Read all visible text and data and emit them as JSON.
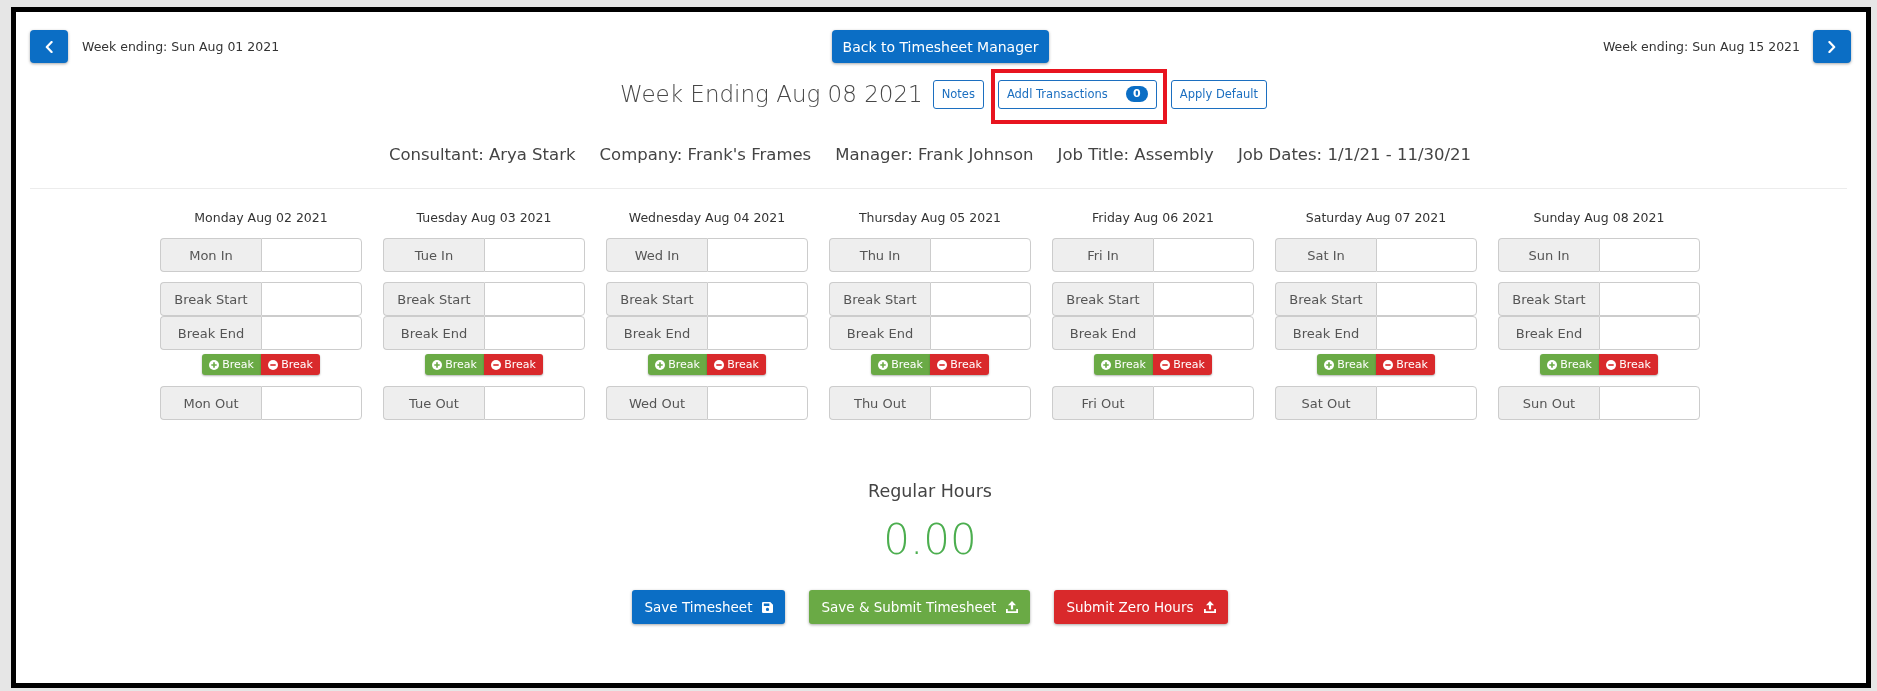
{
  "nav": {
    "previous_week": "Week ending: Sun Aug 01 2021",
    "back_button": "Back to Timesheet Manager",
    "next_week": "Week ending: Sun Aug 15 2021"
  },
  "header": {
    "title": "Week Ending Aug 08 2021",
    "buttons": [
      {
        "label": "Notes",
        "highlighted": false
      },
      {
        "label": "Addl Transactions",
        "badge": "0",
        "highlighted": true
      },
      {
        "label": "Apply Default",
        "highlighted": false
      }
    ]
  },
  "details": [
    "Consultant: Arya Stark",
    "Company: Frank's Frames",
    "Manager: Frank Johnson",
    "Job Title: Assembly",
    "Job Dates: 1/1/21 - 11/30/21"
  ],
  "days": [
    {
      "date": "Monday Aug 02 2021",
      "in_label": "Mon In",
      "breaks": [
        {
          "start_label": "Break Start",
          "end_label": "Break End"
        }
      ],
      "add_break": "Break",
      "remove_break": "Break",
      "out_label": "Mon Out"
    },
    {
      "date": "Tuesday Aug 03 2021",
      "in_label": "Tue In",
      "breaks": [
        {
          "start_label": "Break Start",
          "end_label": "Break End"
        }
      ],
      "add_break": "Break",
      "remove_break": "Break",
      "out_label": "Tue Out"
    },
    {
      "date": "Wednesday Aug 04 2021",
      "in_label": "Wed In",
      "breaks": [
        {
          "start_label": "Break Start",
          "end_label": "Break End"
        }
      ],
      "add_break": "Break",
      "remove_break": "Break",
      "out_label": "Wed Out"
    },
    {
      "date": "Thursday Aug 05 2021",
      "in_label": "Thu In",
      "breaks": [
        {
          "start_label": "Break Start",
          "end_label": "Break End"
        }
      ],
      "add_break": "Break",
      "remove_break": "Break",
      "out_label": "Thu Out"
    },
    {
      "date": "Friday Aug 06 2021",
      "in_label": "Fri In",
      "breaks": [
        {
          "start_label": "Break Start",
          "end_label": "Break End"
        }
      ],
      "add_break": "Break",
      "remove_break": "Break",
      "out_label": "Fri Out"
    },
    {
      "date": "Saturday Aug 07 2021",
      "in_label": "Sat In",
      "breaks": [
        {
          "start_label": "Break Start",
          "end_label": "Break End"
        }
      ],
      "add_break": "Break",
      "remove_break": "Break",
      "out_label": "Sat Out"
    },
    {
      "date": "Sunday Aug 08 2021",
      "in_label": "Sun In",
      "breaks": [
        {
          "start_label": "Break Start",
          "end_label": "Break End"
        }
      ],
      "add_break": "Break",
      "remove_break": "Break",
      "out_label": "Sun Out"
    }
  ],
  "totals": {
    "label": "Regular Hours",
    "value": "0.00"
  },
  "actions": [
    {
      "kind": "save",
      "label": "Save Timesheet"
    },
    {
      "kind": "submit",
      "label": "Save & Submit Timesheet"
    },
    {
      "kind": "submit_zero",
      "label": "Submit Zero Hours"
    }
  ]
}
